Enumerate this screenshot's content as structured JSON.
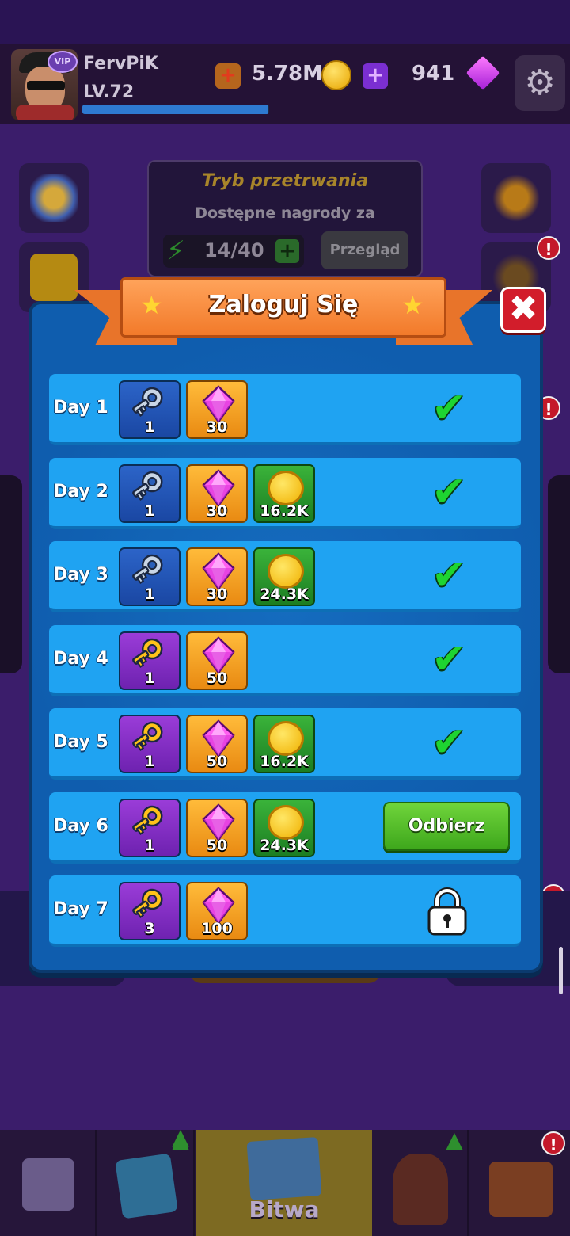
{
  "player": {
    "vip_badge": "VIP",
    "name": "FervPiK",
    "level": "LV.72",
    "xp_fraction": 0.99
  },
  "currency": {
    "coins": "5.78M",
    "gems": "941",
    "plus": "+"
  },
  "background": {
    "mode_title": "Tryb przetrwania",
    "mode_subtitle": "Dostępne nagrody za",
    "energy": "14/40",
    "review_button": "Przegląd",
    "alert": "!"
  },
  "dialog": {
    "title": "Zaloguj Się",
    "close": "✖",
    "claim_label": "Odbierz",
    "checkmark": "✔",
    "days": [
      {
        "label": "Day 1",
        "key_type": "silver",
        "key_count": "1",
        "gems": "30",
        "coins": "",
        "status": "claimed"
      },
      {
        "label": "Day 2",
        "key_type": "silver",
        "key_count": "1",
        "gems": "30",
        "coins": "16.2K",
        "status": "claimed"
      },
      {
        "label": "Day 3",
        "key_type": "silver",
        "key_count": "1",
        "gems": "30",
        "coins": "24.3K",
        "status": "claimed"
      },
      {
        "label": "Day 4",
        "key_type": "gold",
        "key_count": "1",
        "gems": "50",
        "coins": "",
        "status": "claimed"
      },
      {
        "label": "Day 5",
        "key_type": "gold",
        "key_count": "1",
        "gems": "50",
        "coins": "16.2K",
        "status": "claimed"
      },
      {
        "label": "Day 6",
        "key_type": "gold",
        "key_count": "1",
        "gems": "50",
        "coins": "24.3K",
        "status": "claimable"
      },
      {
        "label": "Day 7",
        "key_type": "gold",
        "key_count": "3",
        "gems": "100",
        "coins": "",
        "status": "locked"
      }
    ]
  },
  "nav": {
    "battle_label": "Bitwa"
  },
  "colors": {
    "accent_green": "#3ea71c",
    "row_blue": "#1fa3f2",
    "ribbon_orange": "#f27a2a"
  }
}
